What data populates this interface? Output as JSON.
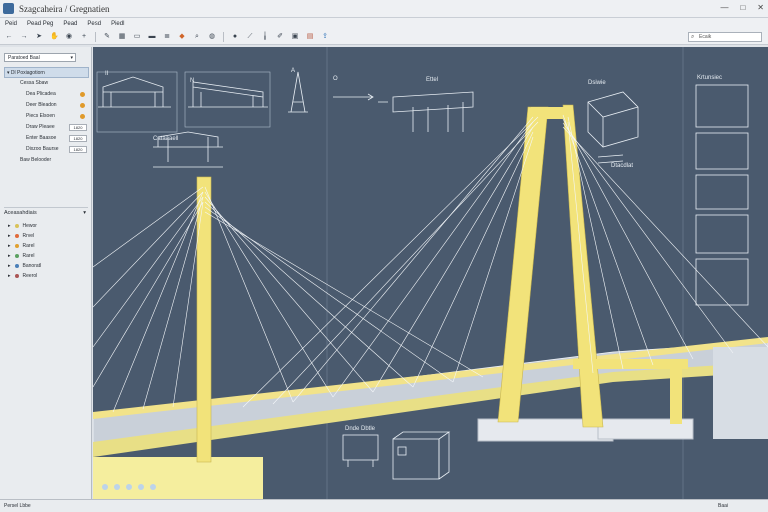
{
  "window": {
    "title": "Szagcaheira / Gregnatien"
  },
  "menu": [
    "Peid",
    "Pead Peg",
    "Pead",
    "Pesd",
    "Piedl"
  ],
  "toolbar_icons": [
    "back-icon",
    "forward-icon",
    "cursor-icon",
    "hand-icon",
    "bulb-icon",
    "plus-icon",
    "pencil-icon",
    "grid-icon",
    "frame-icon",
    "frame-icon",
    "layers-icon",
    "shape-icon",
    "zoom-icon",
    "globe-icon",
    "tool-icon",
    "eyedrop-icon",
    "tool-icon",
    "brush-icon",
    "square-icon",
    "book-icon",
    "share-icon"
  ],
  "search": {
    "placeholder": "Ecaik"
  },
  "sidebar": {
    "dropdown": "Paratoed Baal",
    "tree": [
      {
        "label": "Dl Poxiagotiorn",
        "indent": 0,
        "selected": true
      },
      {
        "label": "Cessa Sbaw",
        "indent": 1
      },
      {
        "label": "Dea Plicadea",
        "indent": 1,
        "badge": true
      },
      {
        "label": "Deer Bleadon",
        "indent": 1,
        "badge": true
      },
      {
        "label": "Piecs Elsoen",
        "indent": 1,
        "badge": true
      },
      {
        "label": "Draw Pleaee",
        "indent": 1,
        "value": "1820"
      },
      {
        "label": "Enter Baasoe",
        "indent": 1,
        "value": "1820"
      },
      {
        "label": "Dixzoo Baurse",
        "indent": 1,
        "value": "1820"
      },
      {
        "label": "Baw Belooder",
        "indent": 1
      }
    ],
    "layers_title": "Aceasahdiais",
    "layers": [
      {
        "label": "Hewor",
        "color": "#d9c25a"
      },
      {
        "label": "Rrvel",
        "color": "#e06a3a"
      },
      {
        "label": "Rarel",
        "color": "#e0a030"
      },
      {
        "label": "Rarel",
        "color": "#5aa060"
      },
      {
        "label": "Banoratl",
        "color": "#4a7fb8"
      },
      {
        "label": "Reerol",
        "color": "#aa5555"
      }
    ]
  },
  "viewport": {
    "labels": {
      "top1": "Ettel",
      "top2": "Dsiwie",
      "top3": "Krtunsiec",
      "left1": "Cataaaell",
      "mid1": "Dtacdlat",
      "bottom1": "Dnde Dbtle"
    },
    "tag_left": "II",
    "tag_mid": "N",
    "tag_a": "A",
    "tag_o": "O"
  },
  "status": {
    "text": "Persel Lbbe",
    "right": "Baai"
  }
}
